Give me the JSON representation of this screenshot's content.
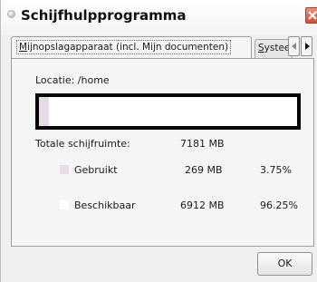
{
  "window": {
    "title": "Schijfhulpprogramma"
  },
  "tabs": [
    {
      "label": "Mijnopslagapparaat (incl. Mijn documenten)",
      "active": true
    },
    {
      "label": "Systeem",
      "active": false
    }
  ],
  "location": {
    "text": "Locatie: /home"
  },
  "disk": {
    "total_label": "Totale schijfruimte:",
    "total_value": "7181 MB",
    "used_label": "Gebruikt",
    "used_value": "269 MB",
    "used_percent": "3.75%",
    "used_fraction": 0.0375,
    "free_label": "Beschikbaar",
    "free_value": "6912 MB",
    "free_percent": "96.25%"
  },
  "colors": {
    "used": "#e7dbe7",
    "free": "#ffffff",
    "bar_border": "#050505"
  },
  "buttons": {
    "ok": "OK"
  },
  "icons": {
    "title": "app-icon",
    "close": "close-icon",
    "scroll_left": "chevron-left-icon",
    "scroll_right": "chevron-right-icon"
  }
}
